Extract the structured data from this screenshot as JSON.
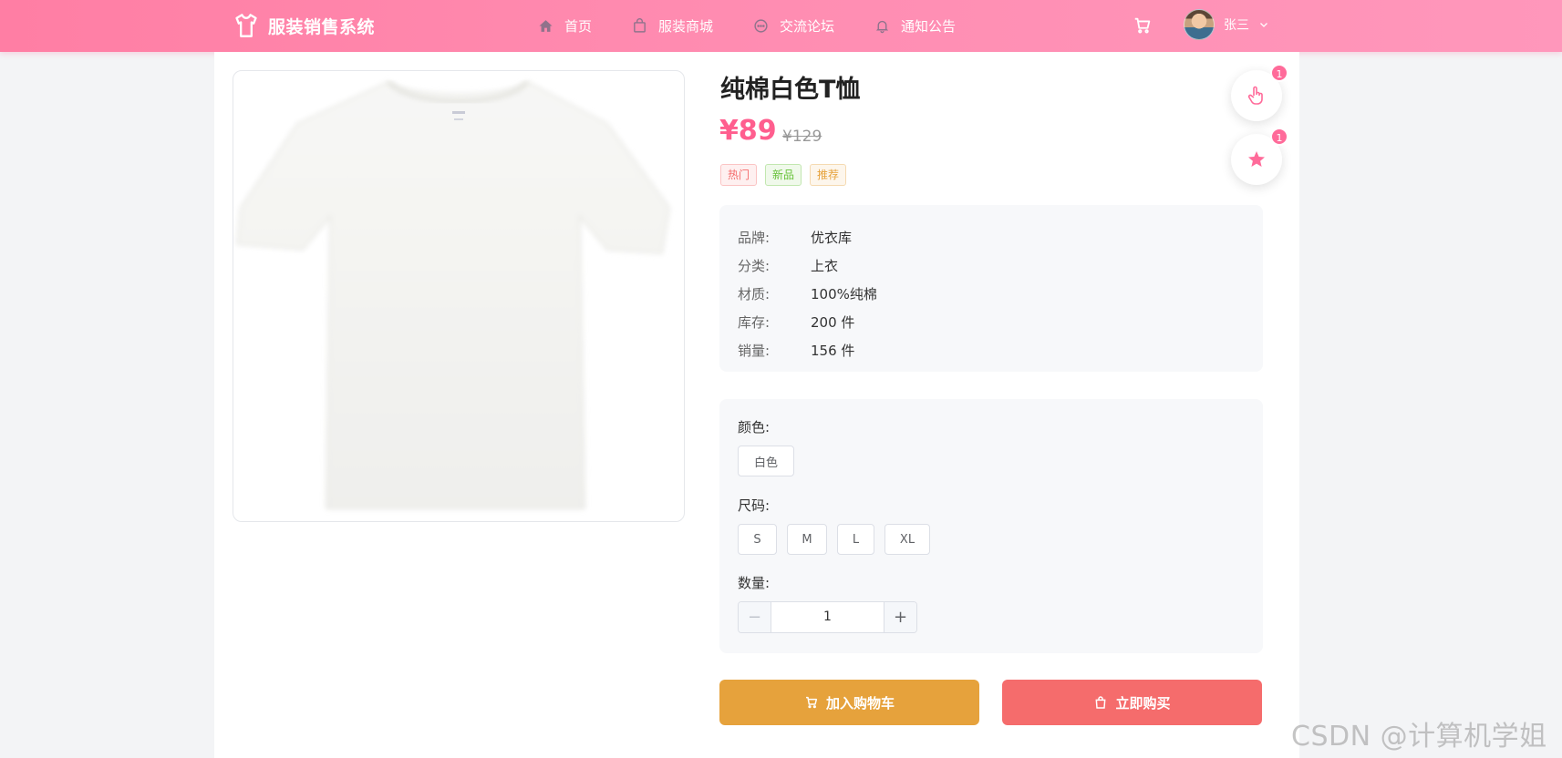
{
  "header": {
    "logo_text": "服装销售系统",
    "nav": [
      {
        "label": "首页",
        "icon": "home-icon"
      },
      {
        "label": "服装商城",
        "icon": "shopping-bag-icon"
      },
      {
        "label": "交流论坛",
        "icon": "chat-icon"
      },
      {
        "label": "通知公告",
        "icon": "bell-icon"
      }
    ],
    "user_name": "张三"
  },
  "product": {
    "title": "纯棉白色T恤",
    "price": "¥89",
    "original_price": "¥129",
    "tags": [
      "热门",
      "新品",
      "推荐"
    ],
    "info": [
      {
        "label": "品牌:",
        "value": "优衣库"
      },
      {
        "label": "分类:",
        "value": "上衣"
      },
      {
        "label": "材质:",
        "value": "100%纯棉"
      },
      {
        "label": "库存:",
        "value": "200 件"
      },
      {
        "label": "销量:",
        "value": "156 件"
      }
    ]
  },
  "options": {
    "color_label": "颜色:",
    "colors": [
      "白色"
    ],
    "size_label": "尺码:",
    "sizes": [
      "S",
      "M",
      "L",
      "XL"
    ],
    "quantity_label": "数量:",
    "quantity": "1"
  },
  "actions": {
    "add_cart": "加入购物车",
    "buy_now": "立即购买"
  },
  "floating": {
    "like_count": "1",
    "favorite_count": "1"
  },
  "watermark": "CSDN @计算机学姐",
  "colors": {
    "brand_pink": "#ff7ea4",
    "price": "#ff5e8e",
    "add_cart": "#e6a23c",
    "buy_now": "#f56c6c"
  }
}
